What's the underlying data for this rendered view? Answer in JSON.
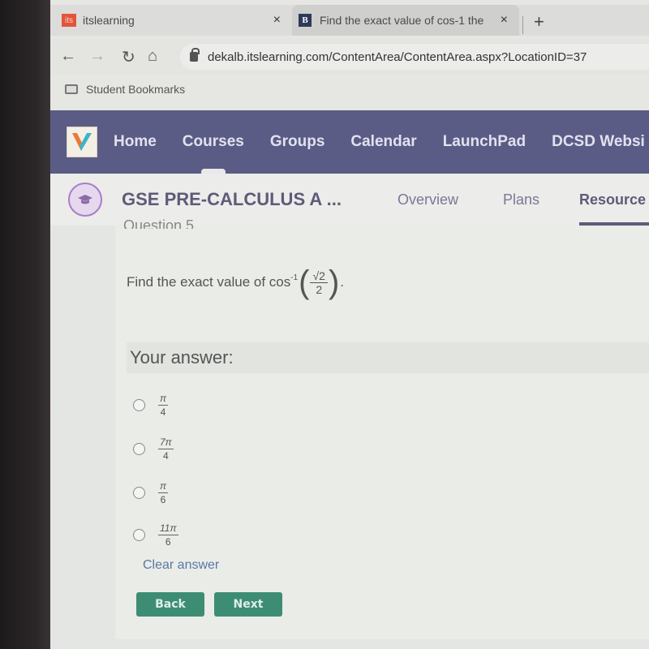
{
  "browser": {
    "tabs": [
      {
        "favicon": "its",
        "title": "itslearning",
        "close": "×"
      },
      {
        "favicon": "B",
        "title": "Find the exact value of cos-1 the",
        "close": "×"
      }
    ],
    "new_tab": "+",
    "url": "dekalb.itslearning.com/ContentArea/ContentArea.aspx?LocationID=37",
    "bookmarks": [
      {
        "label": "Student Bookmarks",
        "icon": "folder-icon"
      }
    ],
    "nav_icons": {
      "back": "←",
      "forward": "→",
      "reload": "↻",
      "home": "⌂"
    }
  },
  "site_nav": {
    "items": [
      {
        "label": "Home"
      },
      {
        "label": "Courses"
      },
      {
        "label": "Groups"
      },
      {
        "label": "Calendar"
      },
      {
        "label": "LaunchPad"
      },
      {
        "label": "DCSD Websi"
      }
    ],
    "active": "Courses"
  },
  "course": {
    "title": "GSE PRE-CALCULUS A ...",
    "tabs": [
      {
        "label": "Overview"
      },
      {
        "label": "Plans"
      },
      {
        "label": "Resource"
      }
    ],
    "active_tab": "Resource"
  },
  "question": {
    "heading_partial": "Question 5",
    "prompt": "Find the exact value of cos",
    "superscript": "-1",
    "numerator": "√2",
    "denominator": "2",
    "trailing": ".",
    "answer_label": "Your answer:",
    "options": [
      {
        "numerator": "π",
        "denominator": "4",
        "selected": false
      },
      {
        "numerator": "7π",
        "denominator": "4",
        "selected": false
      },
      {
        "numerator": "π",
        "denominator": "6",
        "selected": false
      },
      {
        "numerator": "11π",
        "denominator": "6",
        "selected": false
      }
    ],
    "clear_label": "Clear answer",
    "back_label": "Back",
    "next_label": "Next"
  },
  "colors": {
    "site_nav_bg": "#5a5c86",
    "button_green": "#3d8d74",
    "link_blue": "#5a77a6",
    "course_accent": "#a77fc7"
  }
}
